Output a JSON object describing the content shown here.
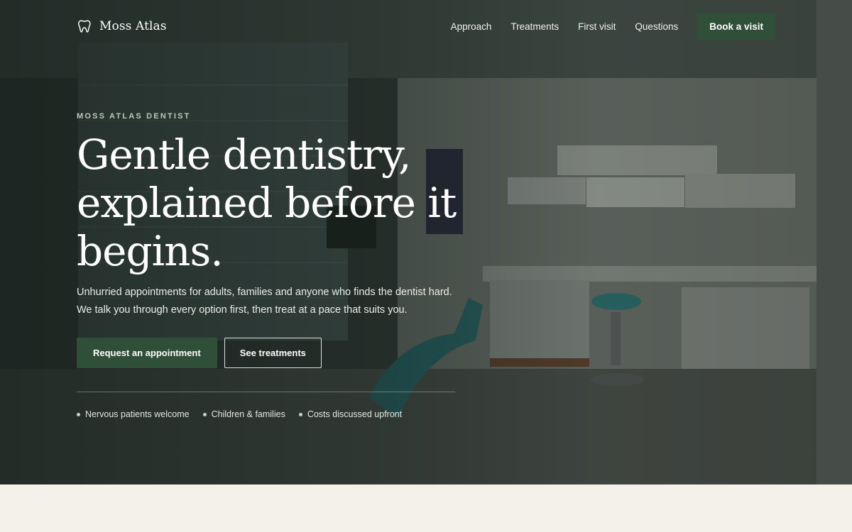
{
  "brand": {
    "name": "Moss Atlas",
    "icon": "tooth-icon"
  },
  "nav": {
    "links": [
      "Approach",
      "Treatments",
      "First visit",
      "Questions"
    ],
    "cta": "Book a visit"
  },
  "hero": {
    "eyebrow": "MOSS ATLAS DENTIST",
    "headline": "Gentle dentistry, explained before it begins.",
    "lede": "Unhurried appointments for adults, families and anyone who finds the dentist hard. We talk you through every option first, then treat at a pace that suits you.",
    "primary_button": "Request an appointment",
    "secondary_button": "See treatments",
    "bullets": [
      "Nervous patients welcome",
      "Children & families",
      "Costs discussed upfront"
    ]
  },
  "colors": {
    "accent": "#2f4f38",
    "eyebrow": "#b9cdb3",
    "page_background": "#f4f1ea"
  }
}
